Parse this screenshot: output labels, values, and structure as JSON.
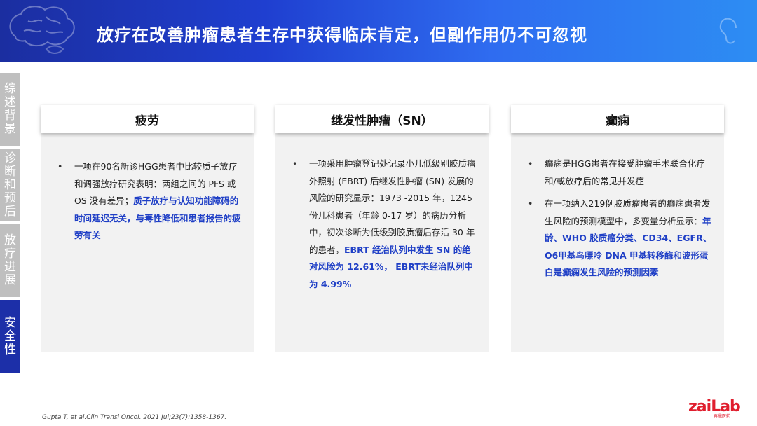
{
  "header": {
    "title": "放疗在改善肿瘤患者生存中获得临床肯定，但副作用仍不可忽视"
  },
  "sidebar": {
    "items": [
      {
        "label": "综述背景",
        "active": false
      },
      {
        "label": "诊断和预后",
        "active": false
      },
      {
        "label": "放疗进展",
        "active": false
      },
      {
        "label": "安全性",
        "active": true
      }
    ]
  },
  "cards": [
    {
      "title": "疲劳",
      "bullets": [
        {
          "text": "一项在90名新诊HGG患者中比较质子放疗和调强放疗研究表明：两组之间的 PFS 或 OS 没有差异；",
          "highlight": "质子放疗与认知功能障碍的时间延迟无关，与毒性降低和患者报告的疲劳有关"
        }
      ]
    },
    {
      "title": "继发性肿瘤（SN）",
      "bullets": [
        {
          "text": "一项采用肿瘤登记处记录小儿低级别胶质瘤外照射 (EBRT) 后继发性肿瘤 (SN) 发展的风险的研究显示：1973 -2015 年，1245 份儿科患者（年龄 0-17 岁）的病历分析中，初次诊断为低级别胶质瘤后存活 30 年的患者，",
          "highlight": "EBRT 经治队列中发生 SN 的绝对风险为 12.61%， EBRT未经治队列中为 4.99%"
        }
      ]
    },
    {
      "title": "癫痫",
      "bullets": [
        {
          "text": "癫痫是HGG患者在接受肿瘤手术联合化疗和/或放疗后的常见并发症",
          "highlight": ""
        },
        {
          "text": "在一项纳入219例胶质瘤患者的癫痫患者发生风险的预测模型中，多变量分析显示：",
          "highlight": "年龄、WHO 胶质瘤分类、CD34、EGFR、O6甲基鸟嘌呤 DNA 甲基转移酶和波形蛋白是癫痫发生风险的预测因素"
        }
      ]
    }
  ],
  "footer": {
    "reference": "Gupta T, et al.Clin Transl Oncol. 2021 Jul;23(7):1358-1367.",
    "logo_text": "zaiLab",
    "logo_sub": "再鼎医药"
  },
  "colors": {
    "banner_start": "#1b2ea0",
    "banner_end": "#2d8df3",
    "highlight": "#1f3fc6",
    "sidebar_active": "#1c2fa8",
    "sidebar_inactive": "#bfbfbf",
    "logo": "#e01e2e"
  }
}
